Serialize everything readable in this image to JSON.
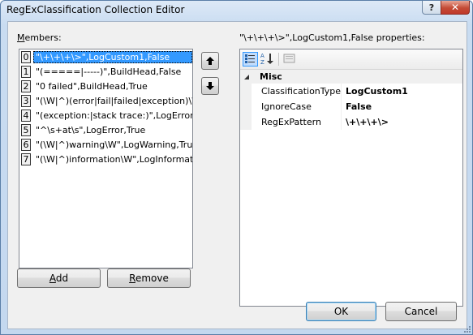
{
  "window": {
    "title": "RegExClassification Collection Editor",
    "help_label": "?",
    "close_label": "✕"
  },
  "members": {
    "label_underlined": "M",
    "label_rest": "embers:",
    "items": [
      {
        "index": "0",
        "value": "\"\\+\\+\\+\\>\",LogCustom1,False",
        "selected": true
      },
      {
        "index": "1",
        "value": "\"(=====|-----)\",BuildHead,False",
        "selected": false
      },
      {
        "index": "2",
        "value": "\"0 failed\",BuildHead,True",
        "selected": false
      },
      {
        "index": "3",
        "value": "\"(\\W|^)(error|fail|failed|exception)\\W",
        "selected": false
      },
      {
        "index": "4",
        "value": "\"(exception:|stack trace:)\",LogError,T",
        "selected": false
      },
      {
        "index": "5",
        "value": "\"^\\s+at\\s\",LogError,True",
        "selected": false
      },
      {
        "index": "6",
        "value": "\"(\\W|^)warning\\W\",LogWarning,Tru",
        "selected": false
      },
      {
        "index": "7",
        "value": "\"(\\W|^)information\\W\",LogInformat",
        "selected": false
      }
    ],
    "up_icon": "up-arrow-icon",
    "down_icon": "down-arrow-icon"
  },
  "buttons": {
    "add_underlined": "A",
    "add_rest": "dd",
    "remove_underlined": "R",
    "remove_rest": "emove",
    "ok": "OK",
    "cancel": "Cancel"
  },
  "properties": {
    "heading": "\"\\+\\+\\+\\>\",LogCustom1,False properties:",
    "category": "Misc",
    "rows": [
      {
        "name": "ClassificationType",
        "value": "LogCustom1"
      },
      {
        "name": "IgnoreCase",
        "value": "False"
      },
      {
        "name": "RegExPattern",
        "value": "\\+\\+\\+\\>"
      }
    ]
  },
  "colors": {
    "selection": "#3399ff",
    "title_bar": "#c9dcf1",
    "close_button": "#c44b36"
  }
}
